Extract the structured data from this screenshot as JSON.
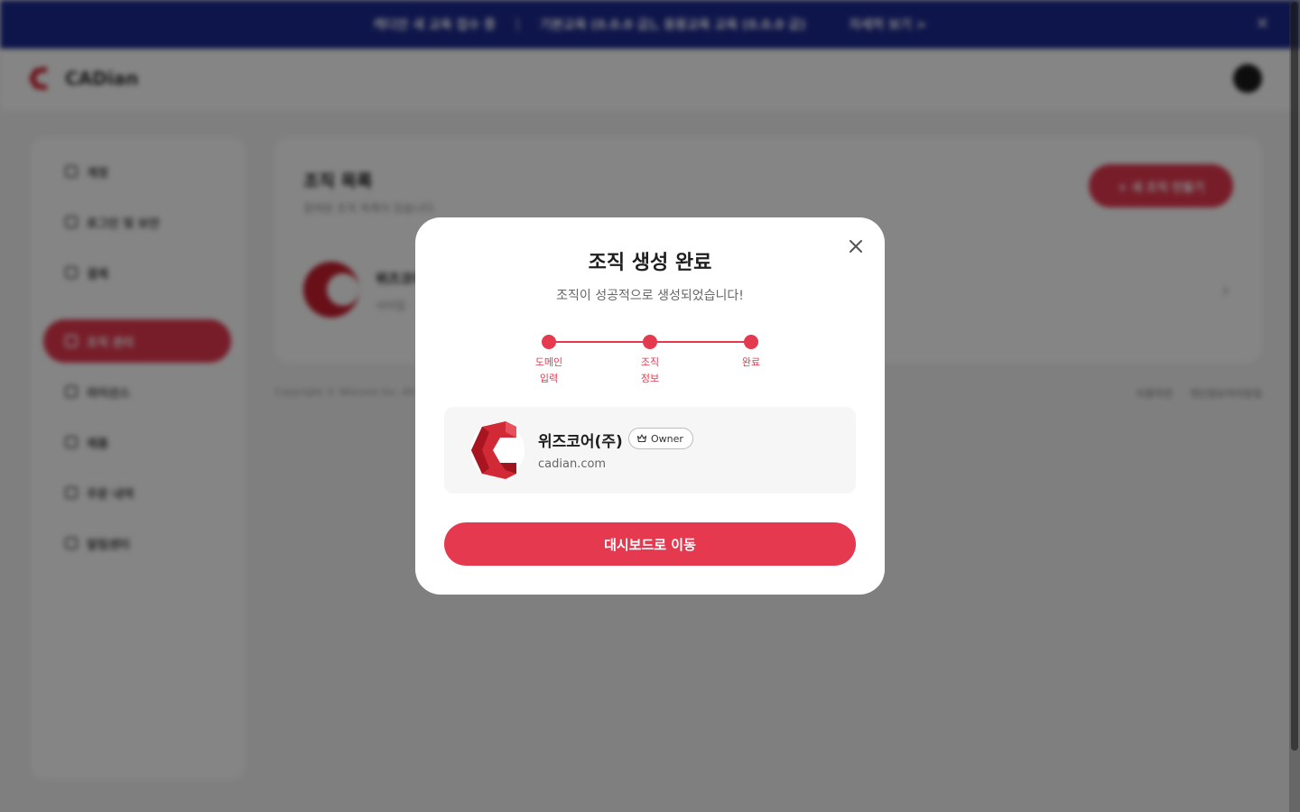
{
  "banner": {
    "text": "캐디안 새 교육 접수 중",
    "separator": "|",
    "schedule": "기본교육 (0.0.0 금), 응용교육 교육 (0.0.0 금)",
    "more_label": "자세히 보기 >",
    "close_icon": "close-icon"
  },
  "header": {
    "logo_text": "CADian",
    "avatar_icon": "avatar"
  },
  "sidebar": {
    "items": [
      {
        "label": "계정",
        "icon": "user-icon",
        "active": false
      },
      {
        "label": "로그인 및 보안",
        "icon": "lock-icon",
        "active": false
      },
      {
        "label": "결제",
        "icon": "card-icon",
        "active": false
      },
      {
        "label": "조직 관리",
        "icon": "team-icon",
        "active": true
      },
      {
        "label": "라이선스",
        "icon": "license-icon",
        "active": false
      },
      {
        "label": "제품",
        "icon": "box-icon",
        "active": false
      },
      {
        "label": "주문 내역",
        "icon": "receipt-icon",
        "active": false
      },
      {
        "label": "알림센터",
        "icon": "bell-icon",
        "active": false
      }
    ]
  },
  "main": {
    "title": "조직 목록",
    "subtitle": "참여된 조직 목록이 있습니다.",
    "add_button": "+ 새 조직 만들기",
    "org_name": "위즈코어",
    "org_sub": "사이업",
    "copyright": "Copyright © Wizcore Inc. All",
    "footer_links": [
      "이용약관",
      "개인정보처리방침"
    ]
  },
  "modal": {
    "title": "조직 생성 완료",
    "subtitle": "조직이 성공적으로 생성되었습니다!",
    "close_icon": "close-icon",
    "steps": [
      {
        "label": "도메인\n입력",
        "done": true
      },
      {
        "label": "조직\n정보",
        "done": true
      },
      {
        "label": "완료",
        "done": true
      }
    ],
    "org": {
      "name": "위즈코어(주)",
      "role": "Owner",
      "role_icon": "crown-icon",
      "domain": "cadian.com"
    },
    "primary_button": "대시보드로 이동"
  },
  "colors": {
    "accent": "#e53950",
    "banner": "#1c2a8f",
    "overlay": "rgba(0,0,0,0.48)"
  }
}
